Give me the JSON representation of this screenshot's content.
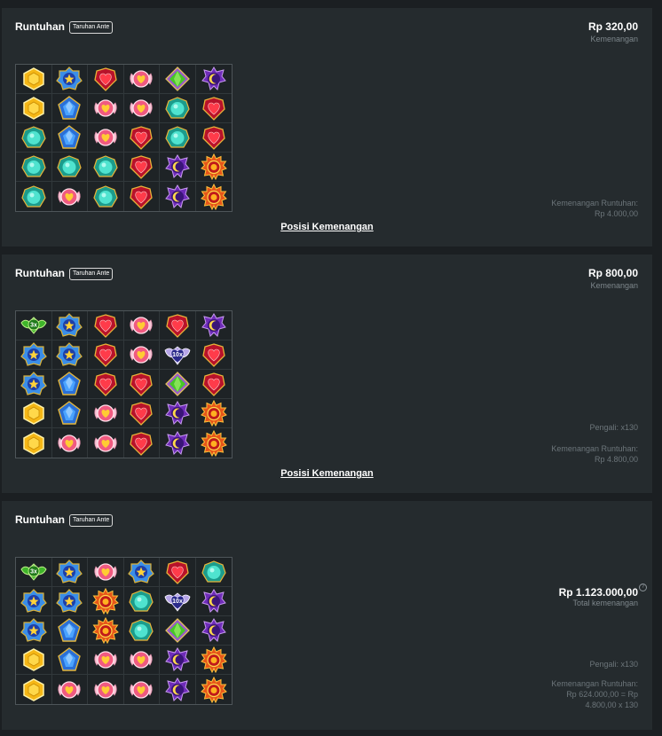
{
  "rounds": [
    {
      "title": "Runtuhan",
      "badge": "Taruhan Ante",
      "amount": "Rp 320,00",
      "amount_label": "Kemenangan",
      "notes": [
        "Kemenangan Runtuhan:",
        "Rp 4.000,00"
      ],
      "link": "Posisi Kemenangan",
      "grid": [
        [
          "gold-hex",
          "blue-star",
          "red-heart",
          "pink-heart-wing",
          "green-diamond",
          "purple-moon"
        ],
        [
          "gold-hex",
          "blue-pentagon",
          "pink-heart-wing",
          "pink-heart-wing",
          "teal-gem",
          "red-heart"
        ],
        [
          "teal-gem",
          "blue-pentagon",
          "pink-heart-wing",
          "red-heart",
          "teal-gem",
          "red-heart"
        ],
        [
          "teal-gem",
          "teal-gem",
          "teal-gem",
          "red-heart",
          "purple-moon",
          "orange-sun"
        ],
        [
          "teal-gem",
          "pink-heart-wing",
          "teal-gem",
          "red-heart",
          "purple-moon",
          "orange-sun"
        ]
      ]
    },
    {
      "title": "Runtuhan",
      "badge": "Taruhan Ante",
      "amount": "Rp 800,00",
      "amount_label": "Kemenangan",
      "multiplier_note": "Pengali: x130",
      "notes": [
        "Kemenangan Runtuhan:",
        "Rp 4.800,00"
      ],
      "link": "Posisi Kemenangan",
      "grid": [
        [
          "green-multiplier",
          "blue-star",
          "red-heart",
          "pink-heart-wing",
          "red-heart",
          "purple-moon"
        ],
        [
          "blue-star",
          "blue-star",
          "red-heart",
          "pink-heart-wing",
          "purple-multiplier",
          "red-heart"
        ],
        [
          "blue-star",
          "blue-pentagon",
          "red-heart",
          "red-heart",
          "green-diamond",
          "red-heart"
        ],
        [
          "gold-hex",
          "blue-pentagon",
          "pink-heart-wing",
          "red-heart",
          "purple-moon",
          "orange-sun"
        ],
        [
          "gold-hex",
          "pink-heart-wing",
          "pink-heart-wing",
          "red-heart",
          "purple-moon",
          "orange-sun"
        ]
      ],
      "multipliers": {
        "green": "3x",
        "purple": "10x"
      }
    },
    {
      "title": "Runtuhan",
      "badge": "Taruhan Ante",
      "amount": "Rp 1.123.000,00",
      "amount_label": "Total kemenangan",
      "help_icon": "question-circle-icon",
      "multiplier_note": "Pengali: x130",
      "notes": [
        "Kemenangan Runtuhan:",
        "Rp 624.000,00 = Rp",
        "4.800,00 x 130"
      ],
      "grid": [
        [
          "green-multiplier",
          "blue-star",
          "pink-heart-wing",
          "blue-star",
          "red-heart",
          "teal-gem"
        ],
        [
          "blue-star",
          "blue-star",
          "orange-sun",
          "teal-gem",
          "purple-multiplier",
          "purple-moon"
        ],
        [
          "blue-star",
          "blue-pentagon",
          "orange-sun",
          "teal-gem",
          "green-diamond",
          "purple-moon"
        ],
        [
          "gold-hex",
          "blue-pentagon",
          "pink-heart-wing",
          "pink-heart-wing",
          "purple-moon",
          "orange-sun"
        ],
        [
          "gold-hex",
          "pink-heart-wing",
          "pink-heart-wing",
          "pink-heart-wing",
          "purple-moon",
          "orange-sun"
        ]
      ],
      "multipliers": {
        "green": "3x",
        "purple": "10x"
      }
    }
  ],
  "colors": {
    "background": "#1b1f22",
    "panel": "#252b2e",
    "muted_text": "#7d868b"
  }
}
